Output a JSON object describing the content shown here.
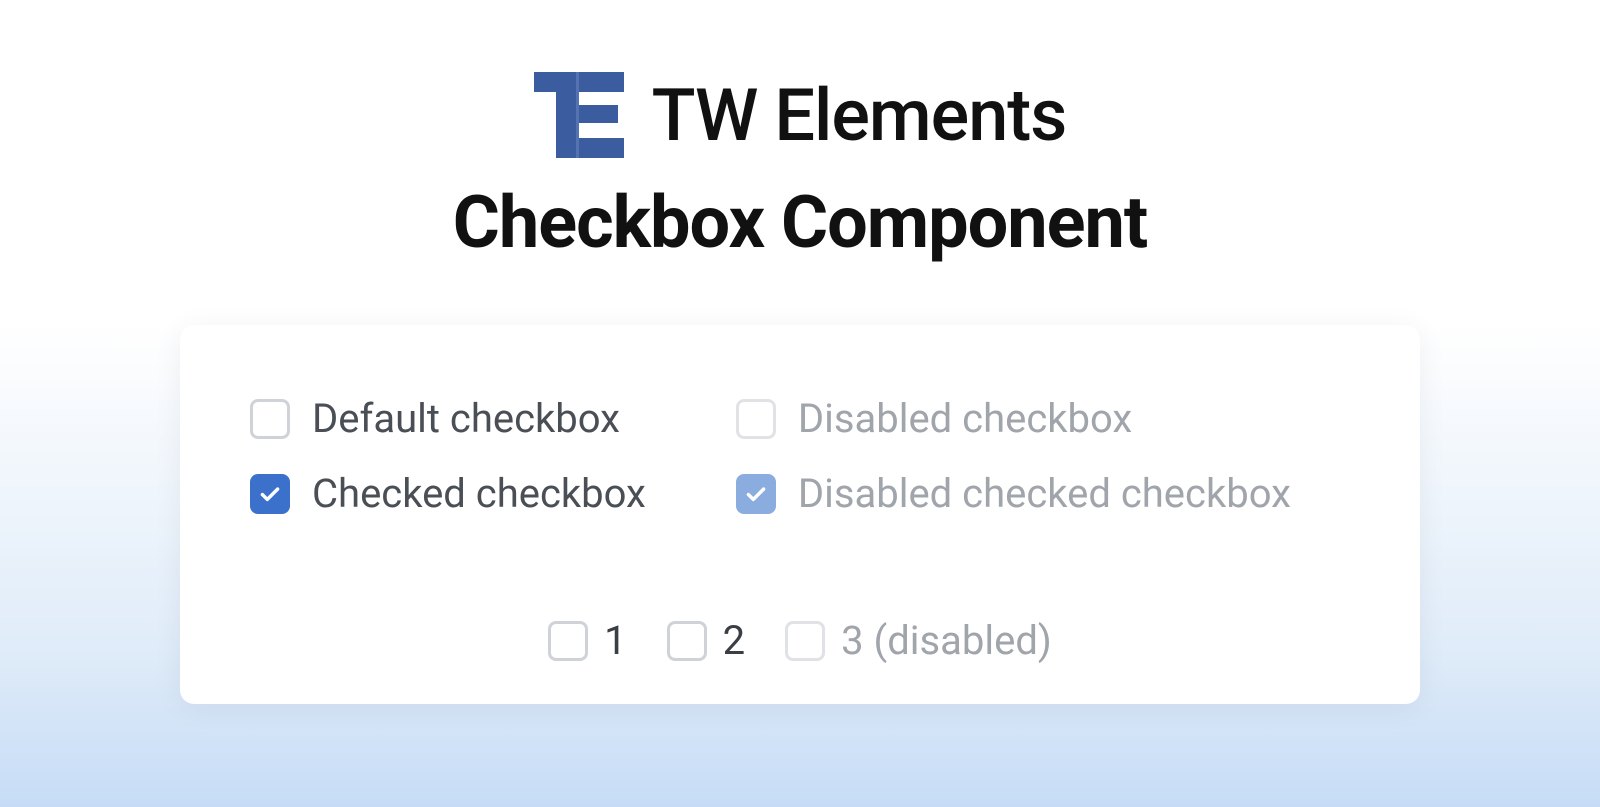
{
  "brand": {
    "name": "TW Elements",
    "logo_color": "#3b5c9f"
  },
  "subtitle": "Checkbox Component",
  "checkboxes": {
    "default": {
      "label": "Default checkbox",
      "checked": false,
      "disabled": false
    },
    "checked": {
      "label": "Checked checkbox",
      "checked": true,
      "disabled": false
    },
    "disabled": {
      "label": "Disabled checkbox",
      "checked": false,
      "disabled": true
    },
    "disabled_checked": {
      "label": "Disabled checked checkbox",
      "checked": true,
      "disabled": true
    }
  },
  "inline": [
    {
      "label": "1",
      "checked": false,
      "disabled": false
    },
    {
      "label": "2",
      "checked": false,
      "disabled": false
    },
    {
      "label": "3 (disabled)",
      "checked": false,
      "disabled": true
    }
  ],
  "colors": {
    "primary": "#3b71ca",
    "primary_light": "#8bacdf",
    "text": "#4a4f56",
    "text_disabled": "#a0a4ab",
    "border": "#cfd3d8"
  }
}
